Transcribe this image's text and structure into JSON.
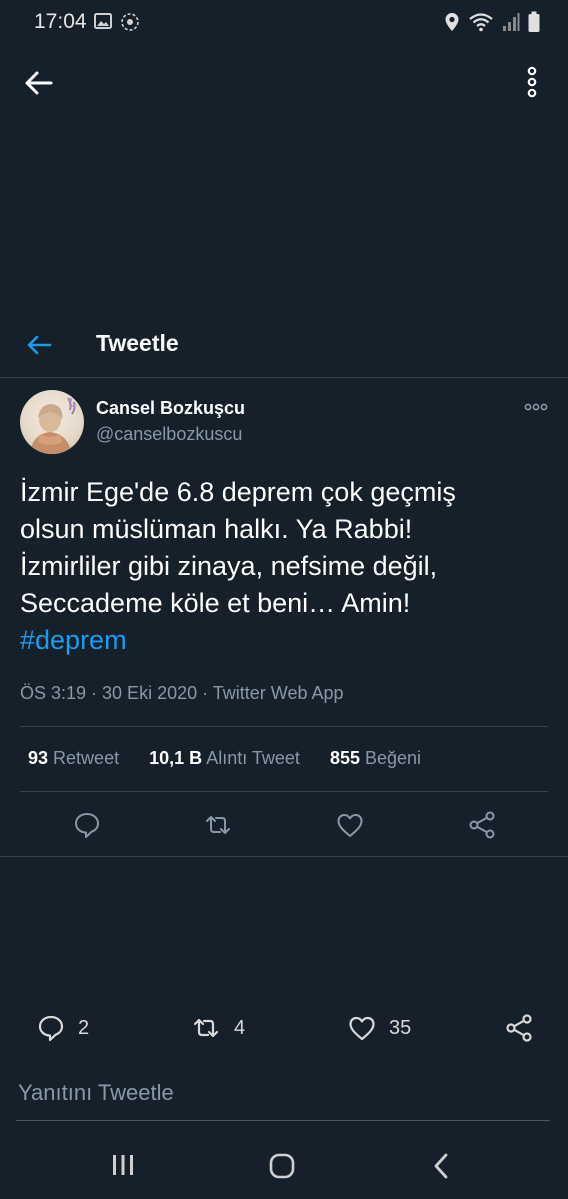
{
  "status_bar": {
    "time": "17:04",
    "left_icons": [
      "gallery-icon",
      "sync-icon"
    ],
    "right_icons": [
      "location-icon",
      "wifi-icon",
      "signal-icon",
      "battery-icon"
    ]
  },
  "header": {
    "title": "Tweetle"
  },
  "tweet": {
    "author_name": "Cansel Bozkuşcu",
    "author_handle": "@canselbozkuscu",
    "text_lines": [
      "İzmir Ege'de 6.8  deprem çok geçmiş",
      "olsun müslüman halkı. Ya Rabbi!",
      "İzmirliler gibi zinaya, nefsime değil,",
      "Seccademe köle et beni… Amin!"
    ],
    "hashtag": "#deprem",
    "meta": "ÖS 3:19 · 30 Eki 2020 · Twitter Web App",
    "stats": {
      "retweets_count": "93",
      "retweets_label": "Retweet",
      "quotes_count": "10,1 B",
      "quotes_label": "Alıntı Tweet",
      "likes_count": "855",
      "likes_label": "Beğeni"
    }
  },
  "bottom_bar": {
    "reply_count": "2",
    "retweet_count": "4",
    "like_count": "35"
  },
  "reply_input": {
    "placeholder": "Yanıtını Tweetle"
  },
  "colors": {
    "background": "#15202b",
    "accent": "#1d9bf0",
    "muted": "#8899a6",
    "divider": "#38444d"
  }
}
